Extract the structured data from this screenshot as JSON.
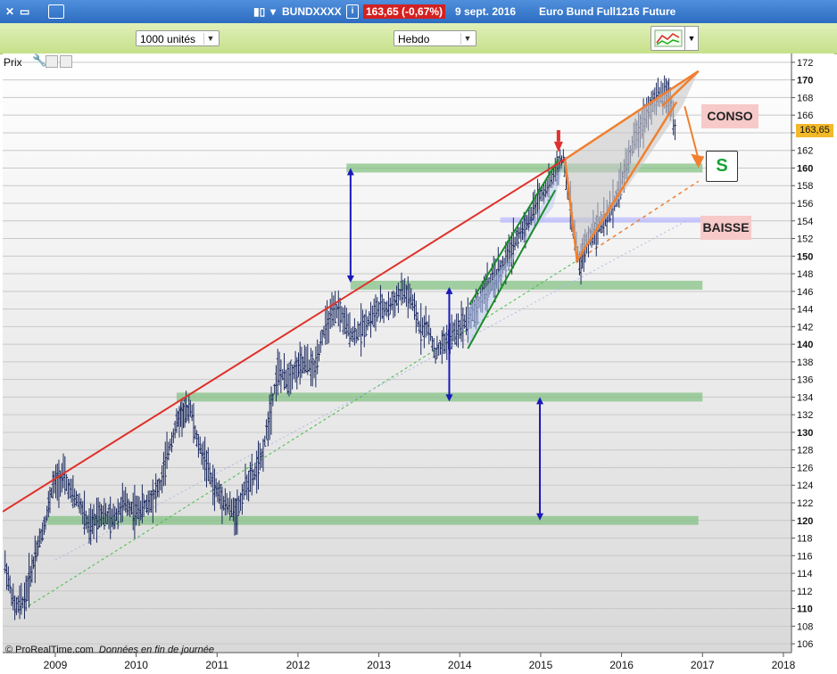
{
  "window": {
    "symbol": "BUNDXXXX",
    "last_price_change": "163,65 (-0,67%)",
    "date_title": "9 sept. 2016",
    "instrument": "Euro Bund Full1216 Future"
  },
  "toolbar": {
    "units_select": "1000 unités",
    "period_select": "Hebdo"
  },
  "pane": {
    "label": "Prix"
  },
  "annotations": {
    "conso": "CONSO",
    "baisse": "BAISSE",
    "s": "S"
  },
  "last_price_tag": "163,65",
  "footer": {
    "source": "© ProRealTime.com",
    "note": "Données en fin de journée"
  },
  "colors": {
    "candles": "#1c2a5e",
    "resistance_line": "#e0302a",
    "green_channel": "#1a8a2a",
    "wedge": "#f08030",
    "support_zone": "#7fbf7f",
    "baisse_zone": "#b8b8ff",
    "arrows": "#1a1ab8",
    "dashed_green": "#44bb44",
    "dashed_orange": "#f08030"
  },
  "chart_data": {
    "type": "candlestick",
    "timeframe": "weekly",
    "x_ticks": [
      "2009",
      "2010",
      "2011",
      "2012",
      "2013",
      "2014",
      "2015",
      "2016",
      "2017",
      "2018"
    ],
    "y_ticks": [
      106,
      108,
      110,
      112,
      114,
      116,
      118,
      120,
      122,
      124,
      126,
      128,
      130,
      132,
      134,
      136,
      138,
      140,
      142,
      144,
      146,
      148,
      150,
      152,
      154,
      156,
      158,
      160,
      162,
      164,
      166,
      168,
      170,
      172
    ],
    "ylim": [
      105,
      173
    ],
    "xlim": [
      2008.35,
      2018.1
    ],
    "last_price": 163.65,
    "price_path": [
      [
        2008.38,
        115
      ],
      [
        2008.5,
        110
      ],
      [
        2008.62,
        111
      ],
      [
        2008.75,
        116
      ],
      [
        2008.88,
        120
      ],
      [
        2008.97,
        124
      ],
      [
        2009.1,
        125
      ],
      [
        2009.2,
        123
      ],
      [
        2009.3,
        122
      ],
      [
        2009.42,
        119
      ],
      [
        2009.55,
        121
      ],
      [
        2009.7,
        120
      ],
      [
        2009.85,
        122
      ],
      [
        2010.0,
        121
      ],
      [
        2010.15,
        122
      ],
      [
        2010.3,
        124
      ],
      [
        2010.4,
        128
      ],
      [
        2010.5,
        131
      ],
      [
        2010.55,
        132
      ],
      [
        2010.6,
        132
      ],
      [
        2010.67,
        133
      ],
      [
        2010.75,
        129
      ],
      [
        2010.85,
        127
      ],
      [
        2010.95,
        124
      ],
      [
        2011.1,
        122
      ],
      [
        2011.2,
        121
      ],
      [
        2011.25,
        121
      ],
      [
        2011.35,
        124
      ],
      [
        2011.45,
        125
      ],
      [
        2011.55,
        127
      ],
      [
        2011.65,
        132
      ],
      [
        2011.75,
        137
      ],
      [
        2011.85,
        136
      ],
      [
        2011.95,
        137
      ],
      [
        2012.1,
        138
      ],
      [
        2012.2,
        137
      ],
      [
        2012.3,
        141
      ],
      [
        2012.4,
        143
      ],
      [
        2012.5,
        144
      ],
      [
        2012.6,
        142
      ],
      [
        2012.7,
        141
      ],
      [
        2012.8,
        142
      ],
      [
        2012.9,
        143
      ],
      [
        2013.0,
        144
      ],
      [
        2013.1,
        144
      ],
      [
        2013.2,
        145
      ],
      [
        2013.3,
        146
      ],
      [
        2013.4,
        145
      ],
      [
        2013.5,
        142
      ],
      [
        2013.6,
        142
      ],
      [
        2013.7,
        139
      ],
      [
        2013.8,
        140
      ],
      [
        2013.9,
        141
      ],
      [
        2014.0,
        142
      ],
      [
        2014.1,
        143
      ],
      [
        2014.2,
        144
      ],
      [
        2014.3,
        146
      ],
      [
        2014.4,
        147
      ],
      [
        2014.55,
        149
      ],
      [
        2014.7,
        152
      ],
      [
        2014.85,
        154
      ],
      [
        2015.0,
        157
      ],
      [
        2015.1,
        158
      ],
      [
        2015.2,
        160
      ],
      [
        2015.28,
        161
      ],
      [
        2015.35,
        157
      ],
      [
        2015.42,
        152
      ],
      [
        2015.48,
        149
      ],
      [
        2015.55,
        151
      ],
      [
        2015.65,
        153
      ],
      [
        2015.8,
        154
      ],
      [
        2015.95,
        157
      ],
      [
        2016.05,
        160
      ],
      [
        2016.15,
        163
      ],
      [
        2016.25,
        165
      ],
      [
        2016.35,
        167
      ],
      [
        2016.45,
        168
      ],
      [
        2016.55,
        168.5
      ],
      [
        2016.62,
        167
      ],
      [
        2016.68,
        163.65
      ]
    ],
    "lines": [
      {
        "name": "resistance",
        "points": [
          [
            2008.35,
            121
          ],
          [
            2015.3,
            161
          ],
          [
            2016.95,
            171
          ]
        ]
      },
      {
        "name": "support",
        "points": [
          [
            2008.62,
            110
          ],
          [
            2016.95,
            158.5
          ]
        ]
      },
      {
        "name": "support-extension",
        "points": [
          [
            2015.45,
            149.5
          ],
          [
            2016.95,
            158.5
          ]
        ]
      }
    ],
    "zones": [
      {
        "name": "resistance-zone-160",
        "x": [
          2012.6,
          2017.0
        ],
        "y": 160
      },
      {
        "name": "zone-147",
        "x": [
          2012.65,
          2017.0
        ],
        "y": 146.7
      },
      {
        "name": "zone-134",
        "x": [
          2010.5,
          2017.0
        ],
        "y": 134
      },
      {
        "name": "zone-120",
        "x": [
          2008.9,
          2016.95
        ],
        "y": 120
      },
      {
        "name": "baisse-zone-154",
        "x": [
          2014.5,
          2016.98
        ],
        "y": 154.1
      }
    ],
    "arrows": [
      {
        "name": "arrow-160-147",
        "x": 2012.65,
        "y": [
          160,
          147
        ]
      },
      {
        "name": "arrow-147-134",
        "x": 2013.87,
        "y": [
          146.5,
          133.5
        ]
      },
      {
        "name": "arrow-134-120",
        "x": 2014.99,
        "y": [
          134,
          120
        ]
      }
    ]
  }
}
